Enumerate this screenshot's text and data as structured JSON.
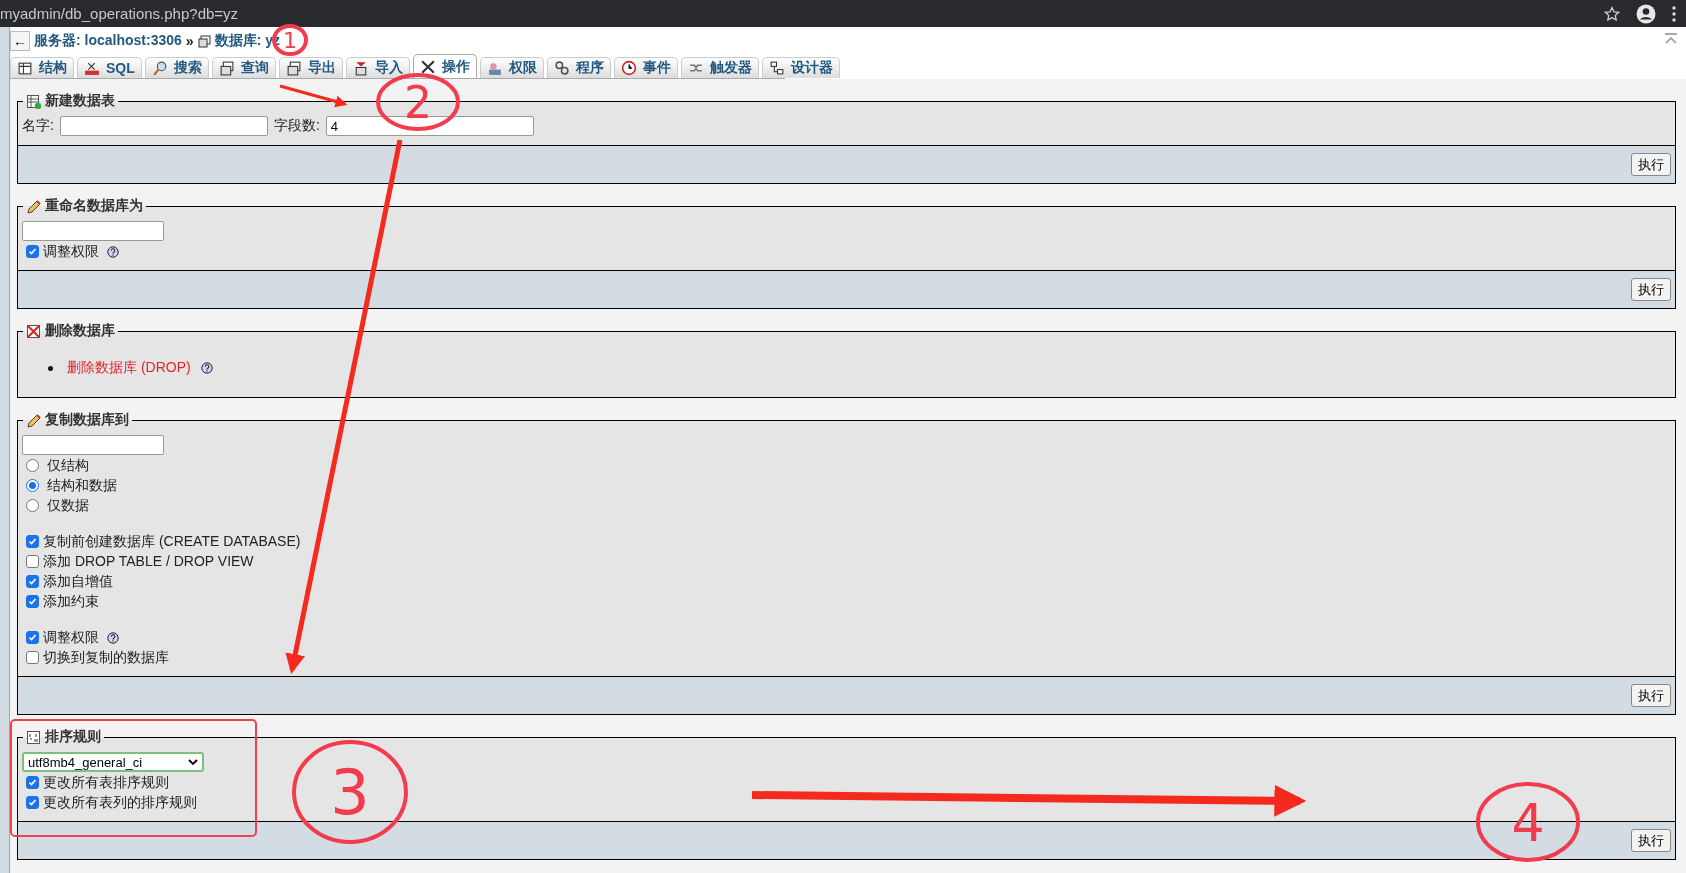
{
  "browser": {
    "url": "myadmin/db_operations.php?db=yz"
  },
  "breadcrumb": {
    "back": "←",
    "server": "服务器: localhost:3306",
    "separator": "»",
    "database": "数据库: yz"
  },
  "tabs": [
    {
      "label": "结构",
      "selected": false
    },
    {
      "label": "SQL",
      "selected": false
    },
    {
      "label": "搜索",
      "selected": false
    },
    {
      "label": "查询",
      "selected": false
    },
    {
      "label": "导出",
      "selected": false
    },
    {
      "label": "导入",
      "selected": false
    },
    {
      "label": "操作",
      "selected": true
    },
    {
      "label": "权限",
      "selected": false
    },
    {
      "label": "程序",
      "selected": false
    },
    {
      "label": "事件",
      "selected": false
    },
    {
      "label": "触发器",
      "selected": false
    },
    {
      "label": "设计器",
      "selected": false
    }
  ],
  "sections": [
    {
      "title": "新建数据表",
      "button": "执行",
      "groups": [
        [
          {
            "kind": "fields",
            "fields": [
              {
                "label": "名字:"
              },
              {
                "label": "字段数:",
                "value": "4"
              }
            ]
          }
        ]
      ]
    },
    {
      "title": "重命名数据库为",
      "button": "执行",
      "groups": [
        [
          {
            "kind": "field"
          },
          {
            "kind": "checkbox",
            "label": "调整权限",
            "checked": true,
            "help": true
          }
        ]
      ]
    },
    {
      "title": "删除数据库",
      "groups": [
        [
          {
            "kind": "link",
            "label": "删除数据库 (DROP)",
            "help": true
          }
        ]
      ]
    },
    {
      "title": "复制数据库到",
      "button": "执行",
      "groups": [
        [
          {
            "kind": "field"
          },
          {
            "kind": "radio",
            "label": "仅结构",
            "selected": false
          },
          {
            "kind": "radio",
            "label": "结构和数据",
            "selected": true
          },
          {
            "kind": "radio",
            "label": "仅数据",
            "selected": false
          }
        ],
        [
          {
            "kind": "checkbox",
            "label": "复制前创建数据库 (CREATE DATABASE)",
            "checked": true
          },
          {
            "kind": "checkbox",
            "label": "添加 DROP TABLE / DROP VIEW",
            "checked": false
          },
          {
            "kind": "checkbox",
            "label": "添加自增值",
            "checked": true
          },
          {
            "kind": "checkbox",
            "label": "添加约束",
            "checked": true
          }
        ],
        [
          {
            "kind": "checkbox",
            "label": "调整权限",
            "checked": true,
            "help": true
          },
          {
            "kind": "checkbox",
            "label": "切换到复制的数据库",
            "checked": false
          }
        ]
      ]
    },
    {
      "title": "排序规则",
      "button": "执行",
      "groups": [
        [
          {
            "kind": "select",
            "value": "utf8mb4_general_ci"
          },
          {
            "kind": "checkbox",
            "label": "更改所有表排序规则",
            "checked": true
          },
          {
            "kind": "checkbox",
            "label": "更改所有表列的排序规则",
            "checked": true
          }
        ]
      ]
    }
  ],
  "annotations": [
    {
      "label": "1"
    },
    {
      "label": "2"
    },
    {
      "label": "3"
    },
    {
      "label": "4"
    }
  ]
}
